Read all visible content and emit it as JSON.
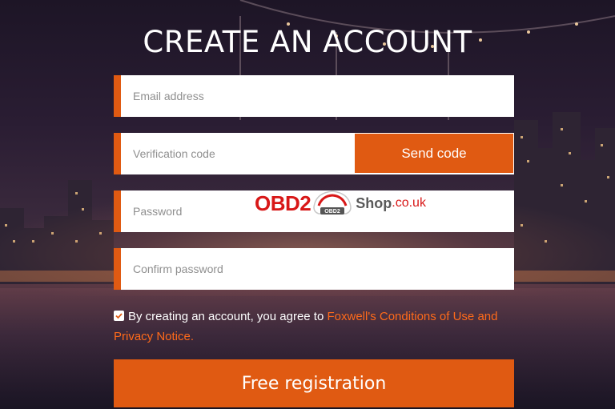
{
  "form": {
    "title": "CREATE AN ACCOUNT",
    "email_placeholder": "Email address",
    "code_placeholder": "Verification code",
    "send_code_label": "Send code",
    "password_placeholder": "Password",
    "confirm_placeholder": "Confirm password",
    "agree_checked": true,
    "agree_text": "By creating an account, you agree to ",
    "agree_link": "Foxwell's Conditions of Use and Privacy Notice.",
    "register_label": "Free registration"
  },
  "watermark": {
    "brand": "OBD2",
    "badge": "OBD2",
    "shop": "Shop",
    "domain": ".co.uk"
  },
  "colors": {
    "accent": "#e05a12",
    "link": "#ff6a1a",
    "watermark_red": "#d81818"
  }
}
